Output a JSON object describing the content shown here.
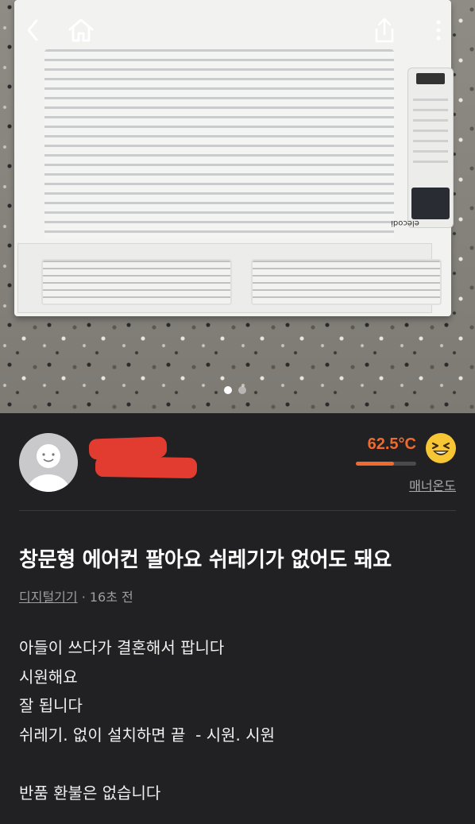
{
  "nav": {
    "back_icon": "chevron-left-icon",
    "home_icon": "home-icon",
    "share_icon": "share-icon",
    "more_icon": "more-vertical-icon"
  },
  "photo": {
    "brand_label": "elecodi",
    "carousel_index": 1,
    "carousel_count": 2
  },
  "seller": {
    "avatar_icon": "default-avatar-icon",
    "name_redacted": true,
    "manner_temp": "62.5°C",
    "manner_temp_fraction": 0.625,
    "manner_label": "매너온도",
    "emoji_icon": "grinning-squint-face-icon"
  },
  "post": {
    "title": "창문형 에어컨 팔아요  쉬레기가 없어도 돼요",
    "category": "디지털기기",
    "time": " · 16초 전",
    "description_lines": [
      "아들이 쓰다가 결혼해서 팝니다",
      "시원해요",
      "잘 됩니다",
      "쉬레기. 없이 설치하면 끝  - 시원. 시원",
      "",
      "반품 환불은 없습니다"
    ]
  },
  "colors": {
    "background": "#212123",
    "accent": "#ef6a2e",
    "muted": "#9e9ea0"
  }
}
